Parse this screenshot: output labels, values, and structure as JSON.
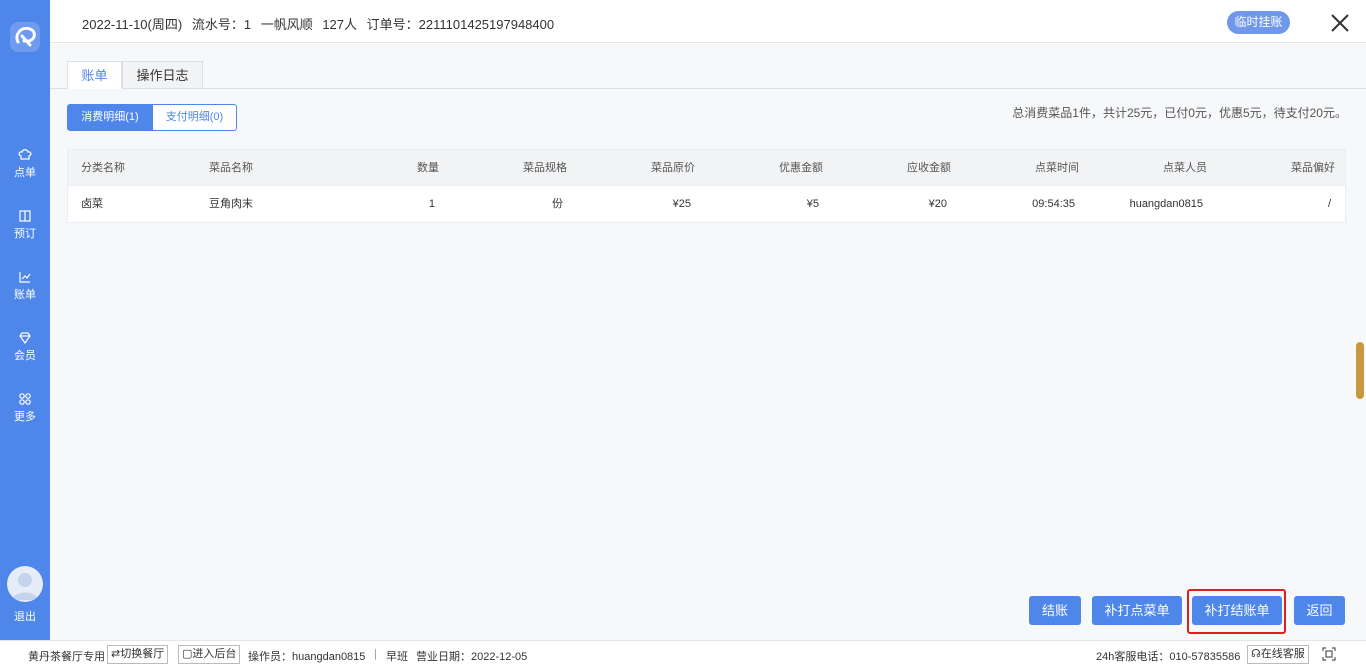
{
  "sidebar": {
    "items": [
      {
        "label": "点单",
        "icon": "chef-hat-icon"
      },
      {
        "label": "预订",
        "icon": "book-icon"
      },
      {
        "label": "账单",
        "icon": "chart-icon"
      },
      {
        "label": "会员",
        "icon": "diamond-icon"
      },
      {
        "label": "更多",
        "icon": "grid-icon"
      }
    ],
    "logout_label": "退出"
  },
  "header": {
    "date": "2022-11-10(周四)",
    "serial": "流水号：1",
    "table": "一帆风顺",
    "guests": "127人",
    "order": "订单号：2211101425197948400",
    "hold_label": "临时挂账"
  },
  "tabs": [
    {
      "label": "账单"
    },
    {
      "label": "操作日志"
    }
  ],
  "segments": [
    {
      "label": "消费明细(1)"
    },
    {
      "label": "支付明细(0)"
    }
  ],
  "summary": "总消费菜品1件，共计25元，已付0元，优惠5元，待支付20元。",
  "table": {
    "headers": [
      "分类名称",
      "菜品名称",
      "数量",
      "菜品规格",
      "菜品原价",
      "优惠金额",
      "应收金额",
      "点菜时间",
      "点菜人员",
      "菜品偏好"
    ],
    "rows": [
      [
        "卤菜",
        "豆角肉末",
        "1",
        "份",
        "¥25",
        "¥5",
        "¥20",
        "09:54:35",
        "huangdan0815",
        "/"
      ]
    ]
  },
  "actions": {
    "checkout": "结账",
    "reprint_order": "补打点菜单",
    "reprint_bill": "补打结账单",
    "back": "返回"
  },
  "footer": {
    "restaurant": "黄丹茶餐厅专用",
    "switch": "切换餐厅",
    "backend": "进入后台",
    "operator": "操作员：huangdan0815",
    "shift": "早班",
    "business_date": "营业日期：2022-12-05",
    "hotline": "24h客服电话：010-57835586",
    "service": "在线客服"
  },
  "colors": {
    "primary": "#4f86ea",
    "highlight": "#e02020"
  }
}
